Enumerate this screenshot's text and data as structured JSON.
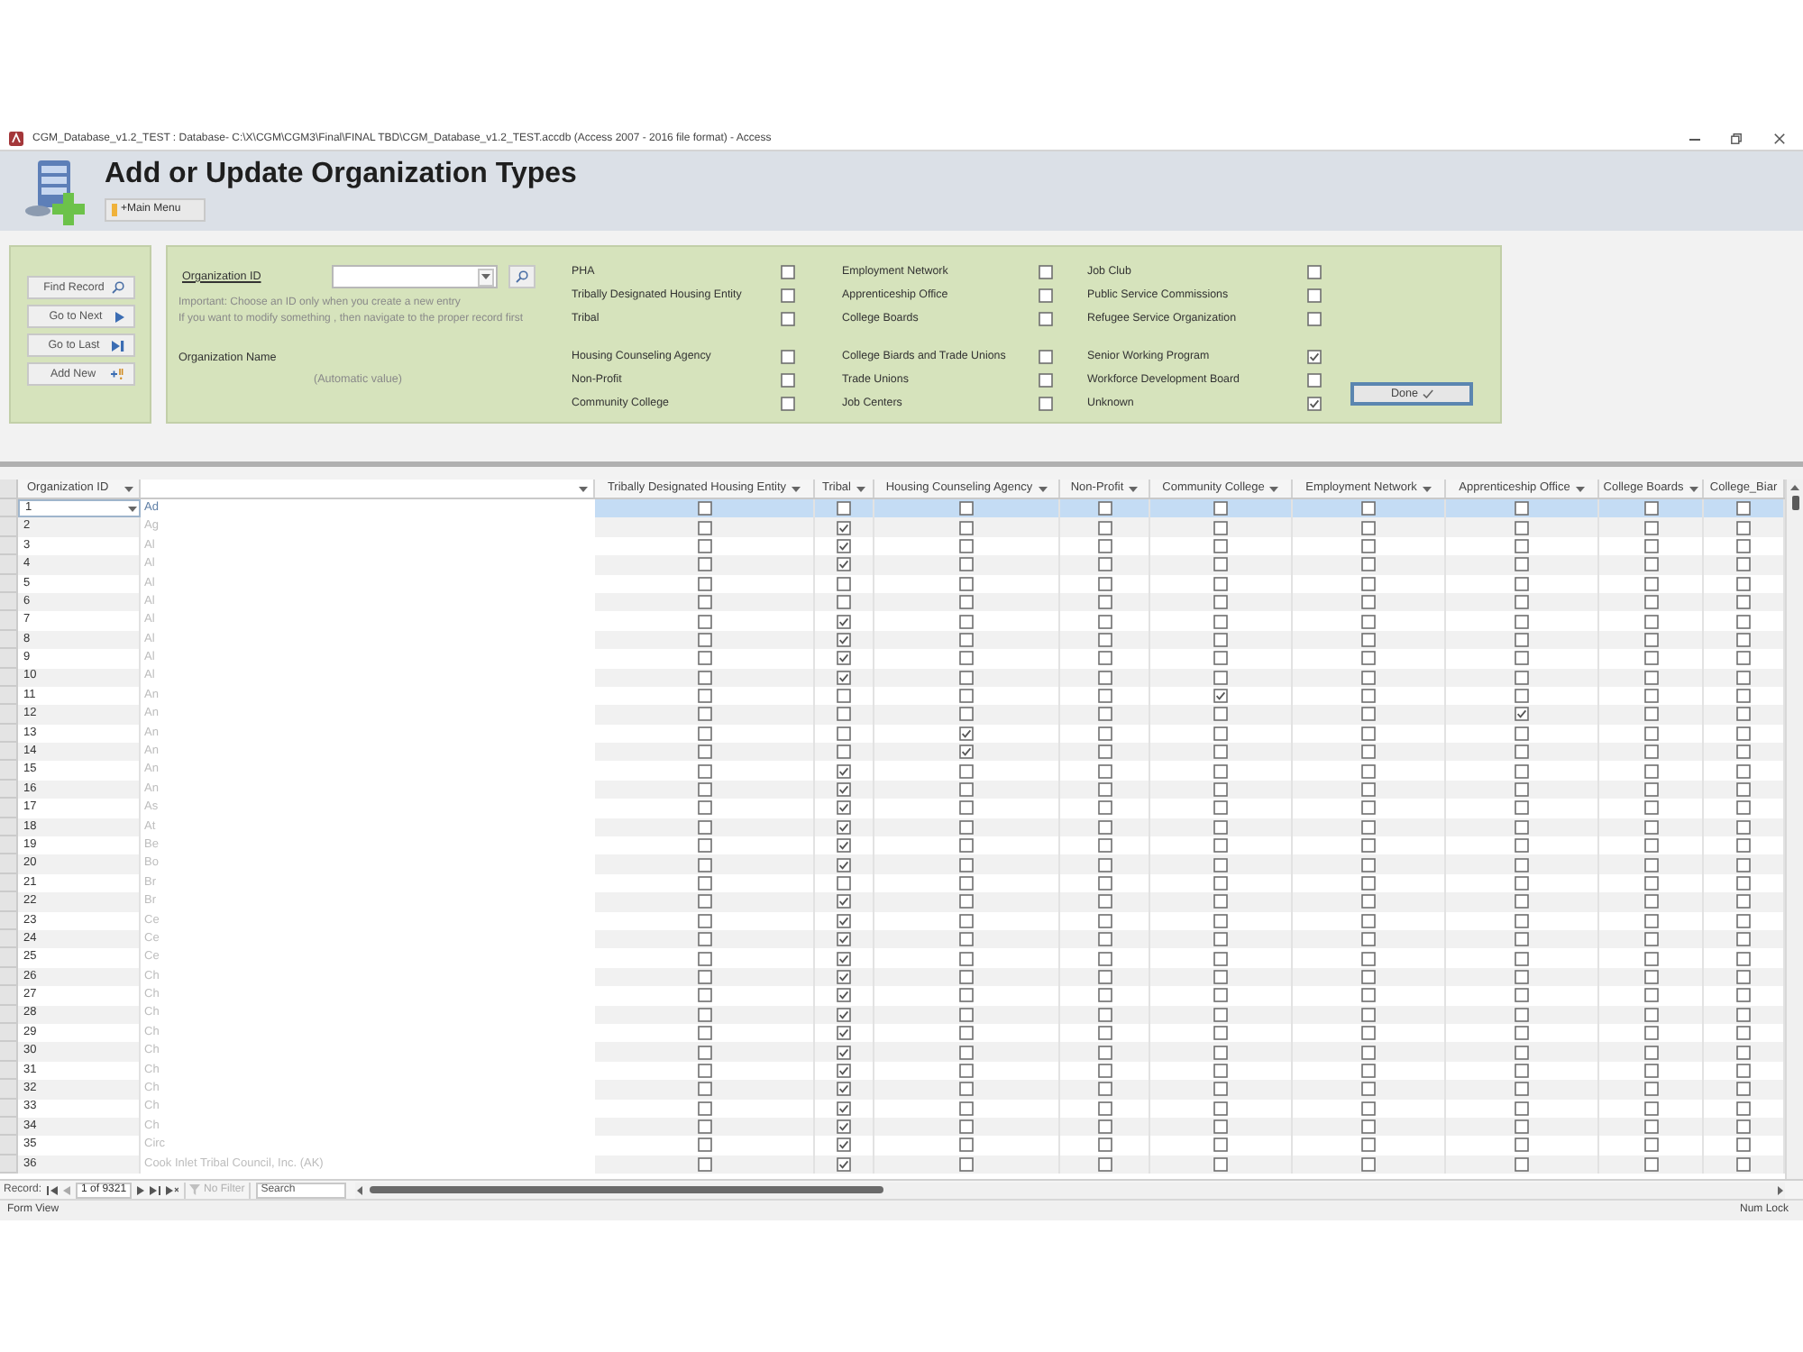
{
  "window": {
    "title": "CGM_Database_v1.2_TEST : Database- C:\\X\\CGM\\CGM3\\Final\\FINAL TBD\\CGM_Database_v1.2_TEST.accdb (Access 2007 - 2016 file format) - Access"
  },
  "header": {
    "title": "Add or Update Organization Types",
    "main_menu_button": "+Main Menu"
  },
  "nav_buttons": [
    {
      "label": "Find Record",
      "kind": "find"
    },
    {
      "label": "Go to Next",
      "kind": "next"
    },
    {
      "label": "Go to Last",
      "kind": "last"
    },
    {
      "label": "Add New",
      "kind": "new"
    }
  ],
  "form": {
    "id_label": "Organization ID",
    "note": [
      "Important: Choose an ID only when you create a new entry",
      "If you want to modify something , then navigate to the proper record first"
    ],
    "name_label": "Organization Name",
    "name_value": "(Automatic value)",
    "checkbox_columns": [
      [
        [
          {
            "label": "PHA",
            "checked": false
          },
          {
            "label": "Tribally Designated Housing Entity",
            "checked": false
          },
          {
            "label": "Tribal",
            "checked": false
          }
        ],
        [
          {
            "label": "Housing Counseling Agency",
            "checked": false
          },
          {
            "label": "Non-Profit",
            "checked": false
          },
          {
            "label": "Community College",
            "checked": false
          }
        ]
      ],
      [
        [
          {
            "label": "Employment Network",
            "checked": false
          },
          {
            "label": "Apprenticeship Office",
            "checked": false
          },
          {
            "label": "College Boards",
            "checked": false
          }
        ],
        [
          {
            "label": "College Biards and Trade Unions",
            "checked": false
          },
          {
            "label": "Trade Unions",
            "checked": false
          },
          {
            "label": "Job Centers",
            "checked": false
          }
        ]
      ],
      [
        [
          {
            "label": "Job Club",
            "checked": false
          },
          {
            "label": "Public Service Commissions",
            "checked": false
          },
          {
            "label": "Refugee Service Organization",
            "checked": false
          }
        ],
        [
          {
            "label": "Senior Working Program",
            "checked": true
          },
          {
            "label": "Workforce Development Board",
            "checked": false
          },
          {
            "label": "Unknown",
            "checked": true
          }
        ]
      ]
    ],
    "done_button": "Done"
  },
  "grid": {
    "id_column": "Organization ID",
    "flag_columns": [
      "Tribally Designated Housing Entity",
      "Tribal",
      "Housing Counseling Agency",
      "Non-Profit",
      "Community College",
      "Employment Network",
      "Apprenticeship Office",
      "College Boards",
      "College_Biar"
    ],
    "rows": [
      {
        "id": "1",
        "name": "Ad",
        "selected": true,
        "checks": [
          false,
          false,
          false,
          false,
          false,
          false,
          false,
          false,
          false
        ]
      },
      {
        "id": "2",
        "name": "Ag",
        "selected": false,
        "checks": [
          false,
          true,
          false,
          false,
          false,
          false,
          false,
          false,
          false
        ]
      },
      {
        "id": "3",
        "name": "Al",
        "selected": false,
        "checks": [
          false,
          true,
          false,
          false,
          false,
          false,
          false,
          false,
          false
        ]
      },
      {
        "id": "4",
        "name": "Al",
        "selected": false,
        "checks": [
          false,
          true,
          false,
          false,
          false,
          false,
          false,
          false,
          false
        ]
      },
      {
        "id": "5",
        "name": "Al",
        "selected": false,
        "checks": [
          false,
          false,
          false,
          false,
          false,
          false,
          false,
          false,
          false
        ]
      },
      {
        "id": "6",
        "name": "Al",
        "selected": false,
        "checks": [
          false,
          false,
          false,
          false,
          false,
          false,
          false,
          false,
          false
        ]
      },
      {
        "id": "7",
        "name": "Al",
        "selected": false,
        "checks": [
          false,
          true,
          false,
          false,
          false,
          false,
          false,
          false,
          false
        ]
      },
      {
        "id": "8",
        "name": "Al",
        "selected": false,
        "checks": [
          false,
          true,
          false,
          false,
          false,
          false,
          false,
          false,
          false
        ]
      },
      {
        "id": "9",
        "name": "Al",
        "selected": false,
        "checks": [
          false,
          true,
          false,
          false,
          false,
          false,
          false,
          false,
          false
        ]
      },
      {
        "id": "10",
        "name": "Al",
        "selected": false,
        "checks": [
          false,
          true,
          false,
          false,
          false,
          false,
          false,
          false,
          false
        ]
      },
      {
        "id": "11",
        "name": "An",
        "selected": false,
        "checks": [
          false,
          false,
          false,
          false,
          true,
          false,
          false,
          false,
          false
        ]
      },
      {
        "id": "12",
        "name": "An",
        "selected": false,
        "checks": [
          false,
          false,
          false,
          false,
          false,
          false,
          true,
          false,
          false
        ]
      },
      {
        "id": "13",
        "name": "An",
        "selected": false,
        "checks": [
          false,
          false,
          true,
          false,
          false,
          false,
          false,
          false,
          false
        ]
      },
      {
        "id": "14",
        "name": "An",
        "selected": false,
        "checks": [
          false,
          false,
          true,
          false,
          false,
          false,
          false,
          false,
          false
        ]
      },
      {
        "id": "15",
        "name": "An",
        "selected": false,
        "checks": [
          false,
          true,
          false,
          false,
          false,
          false,
          false,
          false,
          false
        ]
      },
      {
        "id": "16",
        "name": "An",
        "selected": false,
        "checks": [
          false,
          true,
          false,
          false,
          false,
          false,
          false,
          false,
          false
        ]
      },
      {
        "id": "17",
        "name": "As",
        "selected": false,
        "checks": [
          false,
          true,
          false,
          false,
          false,
          false,
          false,
          false,
          false
        ]
      },
      {
        "id": "18",
        "name": "At",
        "selected": false,
        "checks": [
          false,
          true,
          false,
          false,
          false,
          false,
          false,
          false,
          false
        ]
      },
      {
        "id": "19",
        "name": "Be",
        "selected": false,
        "checks": [
          false,
          true,
          false,
          false,
          false,
          false,
          false,
          false,
          false
        ]
      },
      {
        "id": "20",
        "name": "Bo",
        "selected": false,
        "checks": [
          false,
          true,
          false,
          false,
          false,
          false,
          false,
          false,
          false
        ]
      },
      {
        "id": "21",
        "name": "Br",
        "selected": false,
        "checks": [
          false,
          false,
          false,
          false,
          false,
          false,
          false,
          false,
          false
        ]
      },
      {
        "id": "22",
        "name": "Br",
        "selected": false,
        "checks": [
          false,
          true,
          false,
          false,
          false,
          false,
          false,
          false,
          false
        ]
      },
      {
        "id": "23",
        "name": "Ce",
        "selected": false,
        "checks": [
          false,
          true,
          false,
          false,
          false,
          false,
          false,
          false,
          false
        ]
      },
      {
        "id": "24",
        "name": "Ce",
        "selected": false,
        "checks": [
          false,
          true,
          false,
          false,
          false,
          false,
          false,
          false,
          false
        ]
      },
      {
        "id": "25",
        "name": "Ce",
        "selected": false,
        "checks": [
          false,
          true,
          false,
          false,
          false,
          false,
          false,
          false,
          false
        ]
      },
      {
        "id": "26",
        "name": "Ch",
        "selected": false,
        "checks": [
          false,
          true,
          false,
          false,
          false,
          false,
          false,
          false,
          false
        ]
      },
      {
        "id": "27",
        "name": "Ch",
        "selected": false,
        "checks": [
          false,
          true,
          false,
          false,
          false,
          false,
          false,
          false,
          false
        ]
      },
      {
        "id": "28",
        "name": "Ch",
        "selected": false,
        "checks": [
          false,
          true,
          false,
          false,
          false,
          false,
          false,
          false,
          false
        ]
      },
      {
        "id": "29",
        "name": "Ch",
        "selected": false,
        "checks": [
          false,
          true,
          false,
          false,
          false,
          false,
          false,
          false,
          false
        ]
      },
      {
        "id": "30",
        "name": "Ch",
        "selected": false,
        "checks": [
          false,
          true,
          false,
          false,
          false,
          false,
          false,
          false,
          false
        ]
      },
      {
        "id": "31",
        "name": "Ch",
        "selected": false,
        "checks": [
          false,
          true,
          false,
          false,
          false,
          false,
          false,
          false,
          false
        ]
      },
      {
        "id": "32",
        "name": "Ch",
        "selected": false,
        "checks": [
          false,
          true,
          false,
          false,
          false,
          false,
          false,
          false,
          false
        ]
      },
      {
        "id": "33",
        "name": "Ch",
        "selected": false,
        "checks": [
          false,
          true,
          false,
          false,
          false,
          false,
          false,
          false,
          false
        ]
      },
      {
        "id": "34",
        "name": "Ch",
        "selected": false,
        "checks": [
          false,
          true,
          false,
          false,
          false,
          false,
          false,
          false,
          false
        ]
      },
      {
        "id": "35",
        "name": "Circ",
        "selected": false,
        "checks": [
          false,
          true,
          false,
          false,
          false,
          false,
          false,
          false,
          false
        ]
      },
      {
        "id": "36",
        "name": "Cook Inlet Tribal Council, Inc. (AK)",
        "selected": false,
        "checks": [
          false,
          true,
          false,
          false,
          false,
          false,
          false,
          false,
          false
        ]
      }
    ]
  },
  "record_nav": {
    "label": "Record:",
    "position": "1 of 9321",
    "filter": "No Filter",
    "search": {
      "placeholder": "Search"
    }
  },
  "status_bar": {
    "left": "Form View",
    "right": "Num Lock"
  }
}
